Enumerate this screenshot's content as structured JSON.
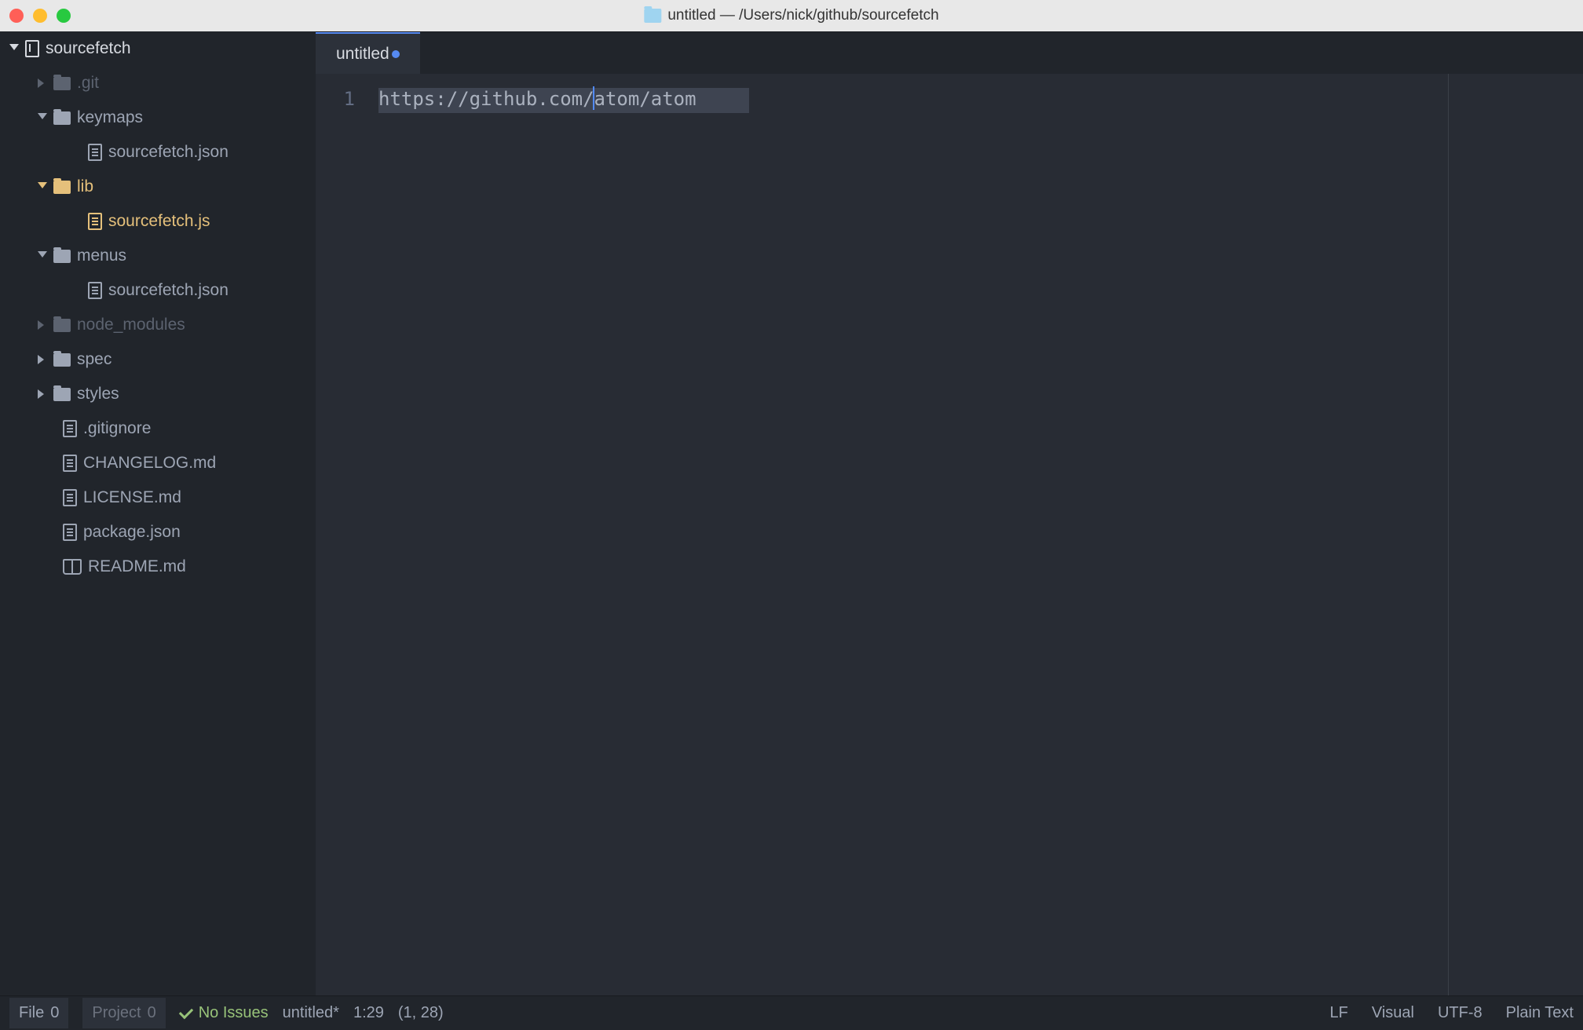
{
  "titlebar": {
    "title": "untitled — /Users/nick/github/sourcefetch"
  },
  "sidebar": {
    "project_name": "sourcefetch",
    "tree": {
      "git": ".git",
      "keymaps": "keymaps",
      "keymaps_file": "sourcefetch.json",
      "lib": "lib",
      "lib_file": "sourcefetch.js",
      "menus": "menus",
      "menus_file": "sourcefetch.json",
      "node_modules": "node_modules",
      "spec": "spec",
      "styles": "styles",
      "gitignore": ".gitignore",
      "changelog": "CHANGELOG.md",
      "license": "LICENSE.md",
      "package": "package.json",
      "readme": "README.md"
    }
  },
  "tab": {
    "label": "untitled"
  },
  "editor": {
    "line_number": "1",
    "line_text": "https://github.com/atom/atom"
  },
  "statusbar": {
    "file_label": "File",
    "file_count": "0",
    "project_label": "Project",
    "project_count": "0",
    "issues": "No Issues",
    "filename": "untitled*",
    "cursor_pos": "1:29",
    "selection": "(1, 28)",
    "line_ending": "LF",
    "mode": "Visual",
    "encoding": "UTF-8",
    "grammar": "Plain Text"
  }
}
